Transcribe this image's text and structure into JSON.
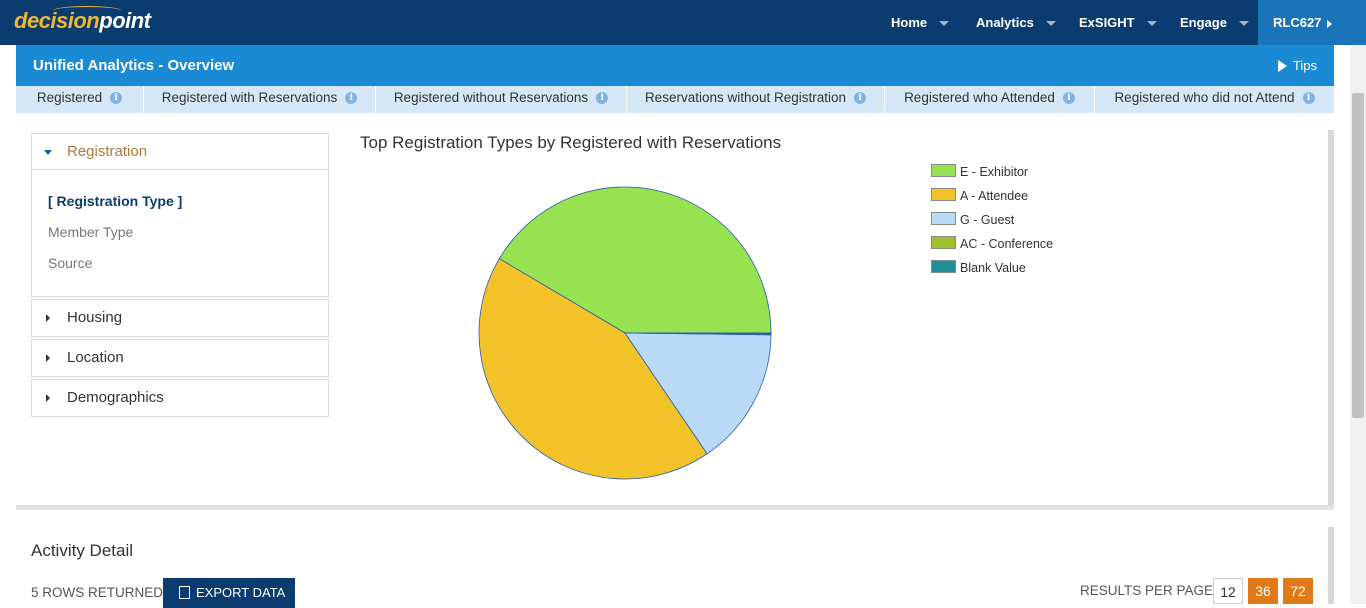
{
  "brand": {
    "part1": "decision",
    "part2": "point"
  },
  "nav": {
    "items": [
      {
        "label": "Home"
      },
      {
        "label": "Analytics"
      },
      {
        "label": "ExSIGHT"
      },
      {
        "label": "Engage"
      }
    ],
    "user": "RLC627"
  },
  "header": {
    "title": "Unified Analytics - Overview",
    "tips": "Tips"
  },
  "metrics": [
    {
      "label": "Registered"
    },
    {
      "label": "Registered with Reservations"
    },
    {
      "label": "Registered without Reservations"
    },
    {
      "label": "Reservations without Registration"
    },
    {
      "label": "Registered who Attended"
    },
    {
      "label": "Registered who did not Attend"
    }
  ],
  "info_glyph": "i",
  "sidebar": {
    "registration": {
      "label": "Registration",
      "options": [
        {
          "label": "[ Registration Type ]"
        },
        {
          "label": "Member Type"
        },
        {
          "label": "Source"
        }
      ]
    },
    "sections": [
      {
        "label": "Housing"
      },
      {
        "label": "Location"
      },
      {
        "label": "Demographics"
      }
    ]
  },
  "chart_data": {
    "type": "pie",
    "title": "Top Registration Types by Registered with Reservations",
    "categories": [
      "E - Exhibitor",
      "A - Attendee",
      "G - Guest",
      "AC - Conference",
      "Blank Value"
    ],
    "values": [
      41.5,
      43.0,
      15.3,
      0.1,
      0.1
    ],
    "colors": [
      "#97e250",
      "#f3c128",
      "#b8daf7",
      "#9bc22a",
      "#1f8f9a"
    ],
    "legend_position": "right"
  },
  "activity": {
    "title": "Activity Detail",
    "rows_returned": "5 ROWS RETURNED",
    "export_label": "EXPORT DATA",
    "results_per_page_label": "RESULTS PER PAGE:",
    "page_sizes": [
      "12",
      "36",
      "72"
    ]
  }
}
